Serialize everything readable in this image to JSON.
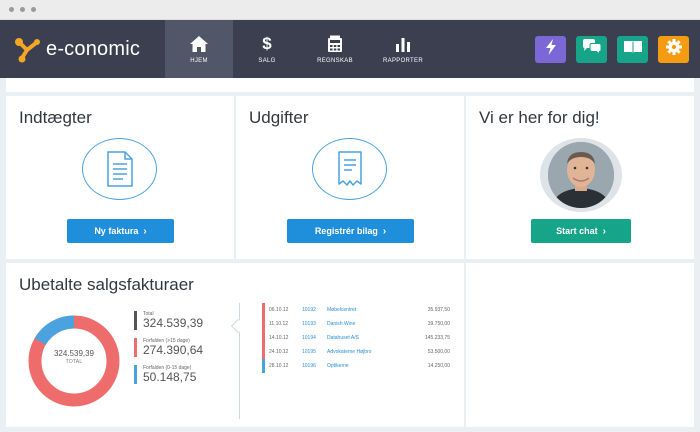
{
  "app": {
    "brand": "e-conomic"
  },
  "nav": {
    "items": [
      {
        "label": "HJEM",
        "icon": "home-icon",
        "active": true
      },
      {
        "label": "SALG",
        "icon": "dollar-icon",
        "glyph": "$"
      },
      {
        "label": "REGNSKAB",
        "icon": "calculator-icon"
      },
      {
        "label": "RAPPORTER",
        "icon": "bar-chart-icon"
      }
    ]
  },
  "toolbar": {
    "buttons": [
      {
        "icon": "lightning-icon",
        "color": "#7b68d6"
      },
      {
        "icon": "chat-icon",
        "color": "#17a589"
      },
      {
        "icon": "book-icon",
        "color": "#17a589"
      },
      {
        "icon": "gear-icon",
        "color": "#f39c12"
      }
    ]
  },
  "panels": {
    "income": {
      "title": "Indtægter",
      "button": "Ny faktura",
      "icon": "document-icon"
    },
    "expenses": {
      "title": "Udgifter",
      "button": "Registrér bilag",
      "icon": "receipt-icon"
    },
    "support": {
      "title": "Vi er her for dig!",
      "button": "Start chat",
      "icon": "avatar"
    }
  },
  "unpaid": {
    "title": "Ubetalte salgsfakturaer",
    "donut": {
      "value": "324.539,39",
      "label": "TOTAL"
    },
    "legend": [
      {
        "label": "Total",
        "value": "324.539,39",
        "color": "#555555"
      },
      {
        "label": "Forfalden (>15 dage)",
        "value": "274.390,64",
        "color": "#ef6c6c"
      },
      {
        "label": "Forfalden (0-15 dage)",
        "value": "50.148,75",
        "color": "#4aa3df"
      }
    ],
    "invoices": [
      {
        "date": "06.10.12",
        "number": "10192",
        "customer": "Møbelcentret",
        "amount": "35.937,50",
        "status": "overdue"
      },
      {
        "date": "11.10.12",
        "number": "10193",
        "customer": "Danish Wine",
        "amount": "39.750,00",
        "status": "overdue"
      },
      {
        "date": "14.10.12",
        "number": "10194",
        "customer": "Datahuset A/S",
        "amount": "145.233,75",
        "status": "overdue"
      },
      {
        "date": "24.10.12",
        "number": "10195",
        "customer": "Advokaterne Højbro",
        "amount": "53.500,00",
        "status": "overdue"
      },
      {
        "date": "28.10.12",
        "number": "10196",
        "customer": "Optikerne",
        "amount": "14.250,00",
        "status": "due"
      }
    ]
  },
  "colors": {
    "header": "#3c3f50",
    "active_nav": "#525669",
    "primary": "#1f8fdc",
    "success": "#17a589",
    "overdue": "#ef6c6c",
    "due": "#4aa3df"
  }
}
